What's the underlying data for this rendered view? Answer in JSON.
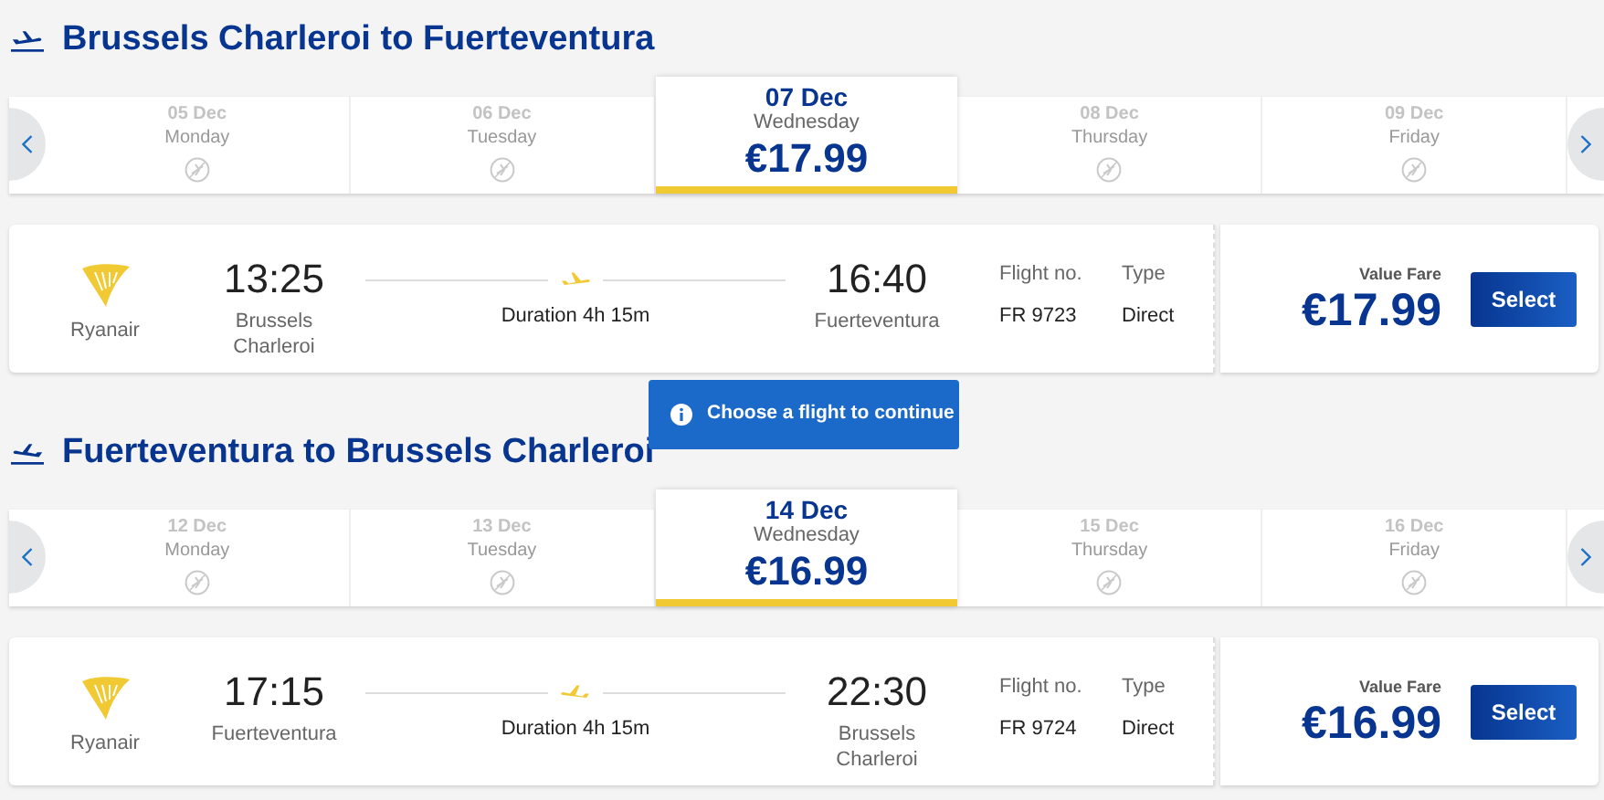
{
  "sections": [
    {
      "kind": "outbound",
      "title": "Brussels Charleroi to Fuerteventura",
      "days": [
        {
          "date": "05 Dec",
          "weekday": "Monday",
          "selected": false
        },
        {
          "date": "06 Dec",
          "weekday": "Tuesday",
          "selected": false
        },
        {
          "date": "07 Dec",
          "weekday": "Wednesday",
          "price": "€17.99",
          "selected": true
        },
        {
          "date": "08 Dec",
          "weekday": "Thursday",
          "selected": false
        },
        {
          "date": "09 Dec",
          "weekday": "Friday",
          "selected": false
        }
      ],
      "flight": {
        "airline": "Ryanair",
        "depart_time": "13:25",
        "depart_city": "Brussels Charleroi",
        "duration": "Duration 4h 15m",
        "arrive_time": "16:40",
        "arrive_city": "Fuerteventura",
        "flight_no_label": "Flight no.",
        "flight_no": "FR 9723",
        "type_label": "Type",
        "type": "Direct",
        "fare_label": "Value Fare",
        "fare": "€17.99",
        "button": "Select"
      }
    },
    {
      "kind": "inbound",
      "title": "Fuerteventura to Brussels Charleroi",
      "days": [
        {
          "date": "12 Dec",
          "weekday": "Monday",
          "selected": false
        },
        {
          "date": "13 Dec",
          "weekday": "Tuesday",
          "selected": false
        },
        {
          "date": "14 Dec",
          "weekday": "Wednesday",
          "price": "€16.99",
          "selected": true
        },
        {
          "date": "15 Dec",
          "weekday": "Thursday",
          "selected": false
        },
        {
          "date": "16 Dec",
          "weekday": "Friday",
          "selected": false
        }
      ],
      "flight": {
        "airline": "Ryanair",
        "depart_time": "17:15",
        "depart_city": "Fuerteventura",
        "duration": "Duration 4h 15m",
        "arrive_time": "22:30",
        "arrive_city": "Brussels Charleroi",
        "flight_no_label": "Flight no.",
        "flight_no": "FR 9724",
        "type_label": "Type",
        "type": "Direct",
        "fare_label": "Value Fare",
        "fare": "€16.99",
        "button": "Select"
      }
    }
  ],
  "tooltip": "Choose a flight to continue"
}
